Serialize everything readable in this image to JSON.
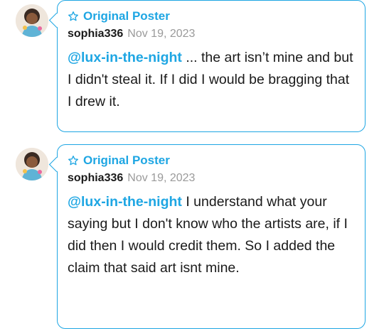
{
  "replies": [
    {
      "badge_icon": "star-outline-icon",
      "badge_label": "Original Poster",
      "username": "sophia336",
      "date": "Nov 19, 2023",
      "mention": "@lux-in-the-night",
      "text": " ... the art isn’t mine and but I didn't steal it. If I did I would be bragging that I drew it."
    },
    {
      "badge_icon": "star-outline-icon",
      "badge_label": "Original Poster",
      "username": "sophia336",
      "date": "Nov 19, 2023",
      "mention": "@lux-in-the-night",
      "text": " I understand what your saying but I don't know who the artists are, if I did then I would credit them. So I added the claim that said art isnt mine."
    }
  ],
  "colors": {
    "accent": "#1ea6e3",
    "muted": "#9a9a9a",
    "text": "#1a1a1a"
  }
}
